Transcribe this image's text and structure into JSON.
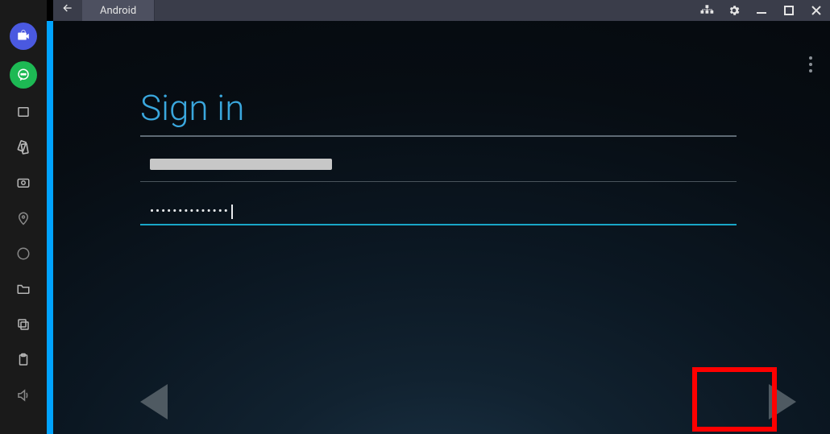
{
  "titlebar": {
    "tab_label": "Android"
  },
  "signin": {
    "heading": "Sign in",
    "password_mask": "••••••••••••••"
  }
}
